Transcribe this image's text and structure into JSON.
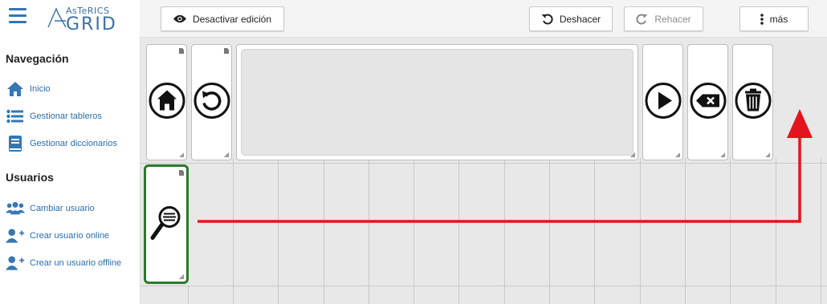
{
  "sidebar": {
    "logo_top": "AsTeRICS",
    "logo_bottom": "GRID",
    "nav_heading": "Navegación",
    "nav_items": [
      {
        "label": "Inicio",
        "icon": "home-icon"
      },
      {
        "label": "Gestionar tableros",
        "icon": "list-icon"
      },
      {
        "label": "Gestionar diccionarios",
        "icon": "book-icon"
      }
    ],
    "users_heading": "Usuarios",
    "user_items": [
      {
        "label": "Cambiar usuario",
        "icon": "users-icon"
      },
      {
        "label": "Crear usuario online",
        "icon": "user-plus-icon"
      },
      {
        "label": "Crear un usuario offline",
        "icon": "user-plus-icon"
      }
    ]
  },
  "toolbar": {
    "edit_toggle_label": "Desactivar edición",
    "undo_label": "Deshacer",
    "redo_label": "Rehacer",
    "more_label": "más"
  },
  "grid_cells": [
    {
      "icon": "home-icon"
    },
    {
      "icon": "undo-icon"
    },
    {
      "icon": "play-icon"
    },
    {
      "icon": "backspace-icon"
    },
    {
      "icon": "trash-icon"
    },
    {
      "icon": "search-icon",
      "selected": true
    }
  ],
  "colors": {
    "accent": "#3576b5",
    "link": "#2a6eb0",
    "selected_border": "#2a7a2a",
    "annotation_arrow": "#e5131b"
  }
}
